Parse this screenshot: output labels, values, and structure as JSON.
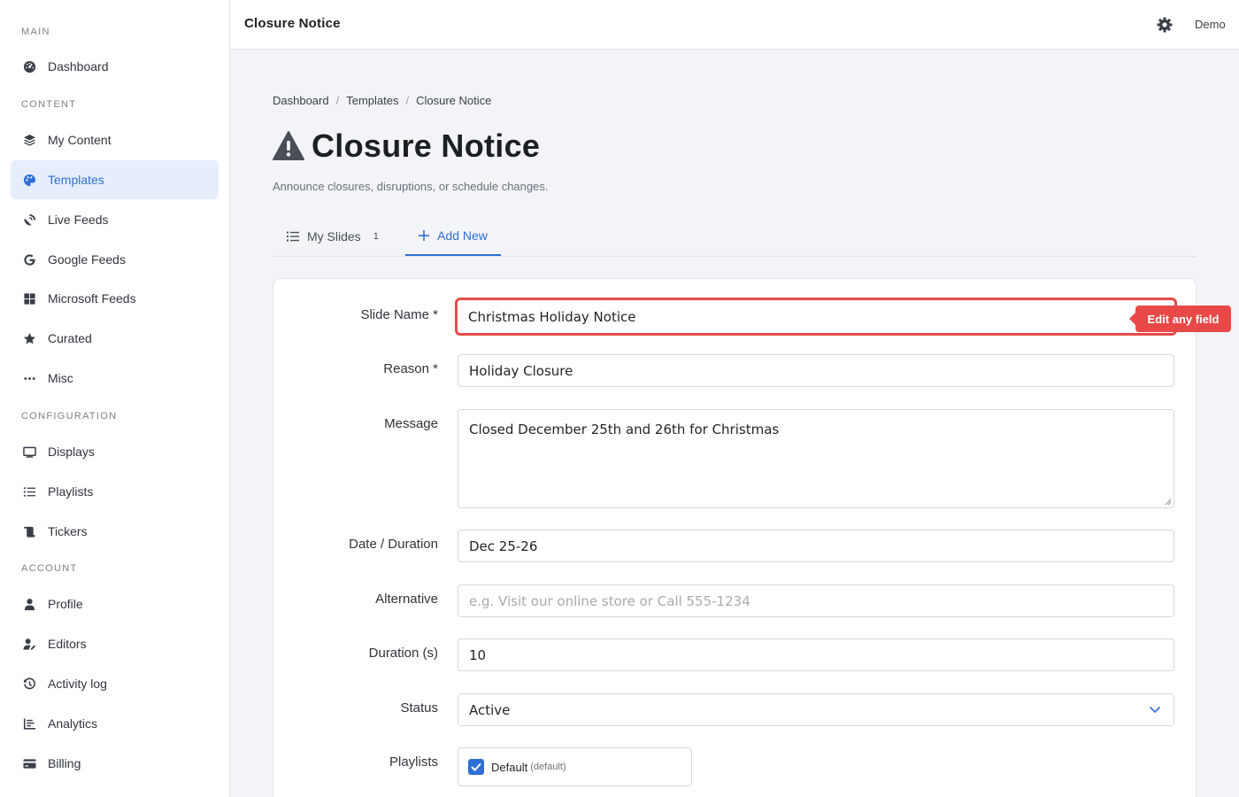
{
  "sidebar": {
    "sections": {
      "main": "MAIN",
      "content": "CONTENT",
      "configuration": "CONFIGURATION",
      "account": "ACCOUNT"
    },
    "items": {
      "dashboard": "Dashboard",
      "my_content": "My Content",
      "templates": "Templates",
      "live_feeds": "Live Feeds",
      "google_feeds": "Google Feeds",
      "microsoft_feeds": "Microsoft Feeds",
      "curated": "Curated",
      "misc": "Misc",
      "displays": "Displays",
      "playlists": "Playlists",
      "tickers": "Tickers",
      "profile": "Profile",
      "editors": "Editors",
      "activity_log": "Activity log",
      "analytics": "Analytics",
      "billing": "Billing"
    },
    "active_item": "Templates"
  },
  "header": {
    "title": "Closure Notice",
    "user": "Demo",
    "settings_icon": "gear-icon"
  },
  "breadcrumb": {
    "items": [
      "Dashboard",
      "Templates",
      "Closure Notice"
    ],
    "separator": "/"
  },
  "page": {
    "title": "Closure Notice",
    "title_icon": "warning-icon",
    "subtitle": "Announce closures, disruptions, or schedule changes."
  },
  "tabs": {
    "my_slides": {
      "label": "My Slides",
      "count": "1"
    },
    "add_new": {
      "label": "Add New",
      "active": true
    }
  },
  "form": {
    "slide_name": {
      "label": "Slide Name *",
      "value": "Christmas Holiday Notice"
    },
    "reason": {
      "label": "Reason *",
      "value": "Holiday Closure"
    },
    "message": {
      "label": "Message",
      "value": "Closed December 25th and 26th for Christmas"
    },
    "date_duration": {
      "label": "Date / Duration",
      "value": "Dec 25-26"
    },
    "alternative": {
      "label": "Alternative",
      "placeholder": "e.g. Visit our online store or Call 555-1234"
    },
    "duration": {
      "label": "Duration (s)",
      "value": "10"
    },
    "status": {
      "label": "Status",
      "value": "Active"
    },
    "playlists": {
      "label": "Playlists",
      "option": "Default",
      "note": "(default)",
      "checked": true
    }
  },
  "tooltip": {
    "text": "Edit any field"
  },
  "colors": {
    "accent": "#2f6fd6",
    "highlight": "#e44b4b",
    "active_bg": "#e6eefb"
  }
}
